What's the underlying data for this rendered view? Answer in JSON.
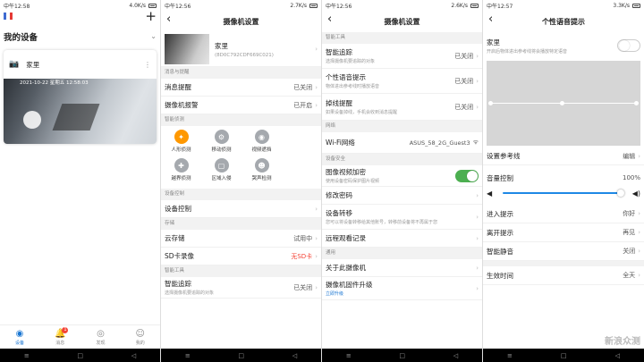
{
  "p1": {
    "status": {
      "time": "中午12:58",
      "net": "4.0K/s"
    },
    "title": "我的设备",
    "add": "+",
    "device_name": "家里",
    "cam_time": "2021-10-22 星期五 12:58:03",
    "tabs": [
      {
        "label": "设备",
        "icon": "◉"
      },
      {
        "label": "消息",
        "icon": "🔔",
        "badge": "1"
      },
      {
        "label": "发现",
        "icon": "◎"
      },
      {
        "label": "我的",
        "icon": "☺"
      }
    ]
  },
  "p2": {
    "status": {
      "time": "中午12:56",
      "net": "2.7K/s"
    },
    "title": "摄像机设置",
    "device": {
      "name": "家里",
      "id": "(8D0C792CDF669C021)"
    },
    "s1": "消息与提醒",
    "msg": {
      "label": "消息提醒",
      "value": "已关闭"
    },
    "alarm": {
      "label": "摄像机报警",
      "value": "已开启"
    },
    "s2": "智能侦测",
    "detect": [
      {
        "label": "人形侦测",
        "icon": "✦"
      },
      {
        "label": "移动侦测",
        "icon": "⚙"
      },
      {
        "label": "视频遮挡",
        "icon": "◉"
      },
      {
        "label": "越界侦测",
        "icon": "✚"
      },
      {
        "label": "区域入侵",
        "icon": "▢"
      },
      {
        "label": "哭声检测",
        "icon": "☻"
      }
    ],
    "s3": "设备控制",
    "ctrl": "设备控制",
    "s4": "存储",
    "cloud": {
      "label": "云存储",
      "value": "试用中"
    },
    "sd": {
      "label": "SD卡录像",
      "value": "无SD卡"
    },
    "s5": "智能工具",
    "track": {
      "label": "智能追踪",
      "sub": "选择摄像机要追踪的对象",
      "value": "已关闭"
    }
  },
  "p3": {
    "status": {
      "time": "中午12:56",
      "net": "2.6K/s"
    },
    "title": "摄像机设置",
    "s1": "智能工具",
    "track": {
      "label": "智能追踪",
      "sub": "选择摄像机要追踪的对象",
      "value": "已关闭"
    },
    "voice": {
      "label": "个性语音提示",
      "sub": "物体进出参考线时播放语音",
      "value": "已关闭"
    },
    "hang": {
      "label": "掉线提醒",
      "sub": "如果设备掉线，手机会收到消息提醒",
      "value": "已关闭"
    },
    "s2": "网络",
    "wifi": {
      "label": "Wi-Fi网络",
      "value": "ASUS_58_2G_Guest3"
    },
    "s3": "设备安全",
    "enc": {
      "label": "图像视频加密",
      "sub": "使用设备密码保护图片视频"
    },
    "pwd": "修改密码",
    "transfer": {
      "label": "设备转移",
      "sub": "您可以将设备转移给其他账号，转移前设备将不再属于您"
    },
    "log": "远程观看记录",
    "s4": "通用",
    "about": "关于此摄像机",
    "fw": {
      "label": "摄像机固件升级",
      "sub": "立即升级"
    }
  },
  "p4": {
    "status": {
      "time": "中午12:57",
      "net": "3.3K/s"
    },
    "title": "个性语音提示",
    "home": {
      "label": "家里",
      "sub": "开启后物体进出参考线将会播放特定语音"
    },
    "ref": {
      "label": "设置参考线",
      "value": "编辑"
    },
    "vol": {
      "label": "音量控制",
      "value": "100%",
      "level": 1.0
    },
    "enter": {
      "label": "进入提示",
      "value": "你好"
    },
    "leave": {
      "label": "离开提示",
      "value": "再见"
    },
    "mute": {
      "label": "智能静音",
      "value": "关闭"
    },
    "time": {
      "label": "生效时间",
      "value": "全天"
    },
    "wm": "新浪众测"
  },
  "navicons": {
    "menu": "≡",
    "home": "□",
    "back": "◁"
  },
  "colors": {
    "accent": "#1976d2",
    "on": "#4caf50",
    "active": "#ff9800",
    "warn": "#f44336"
  }
}
